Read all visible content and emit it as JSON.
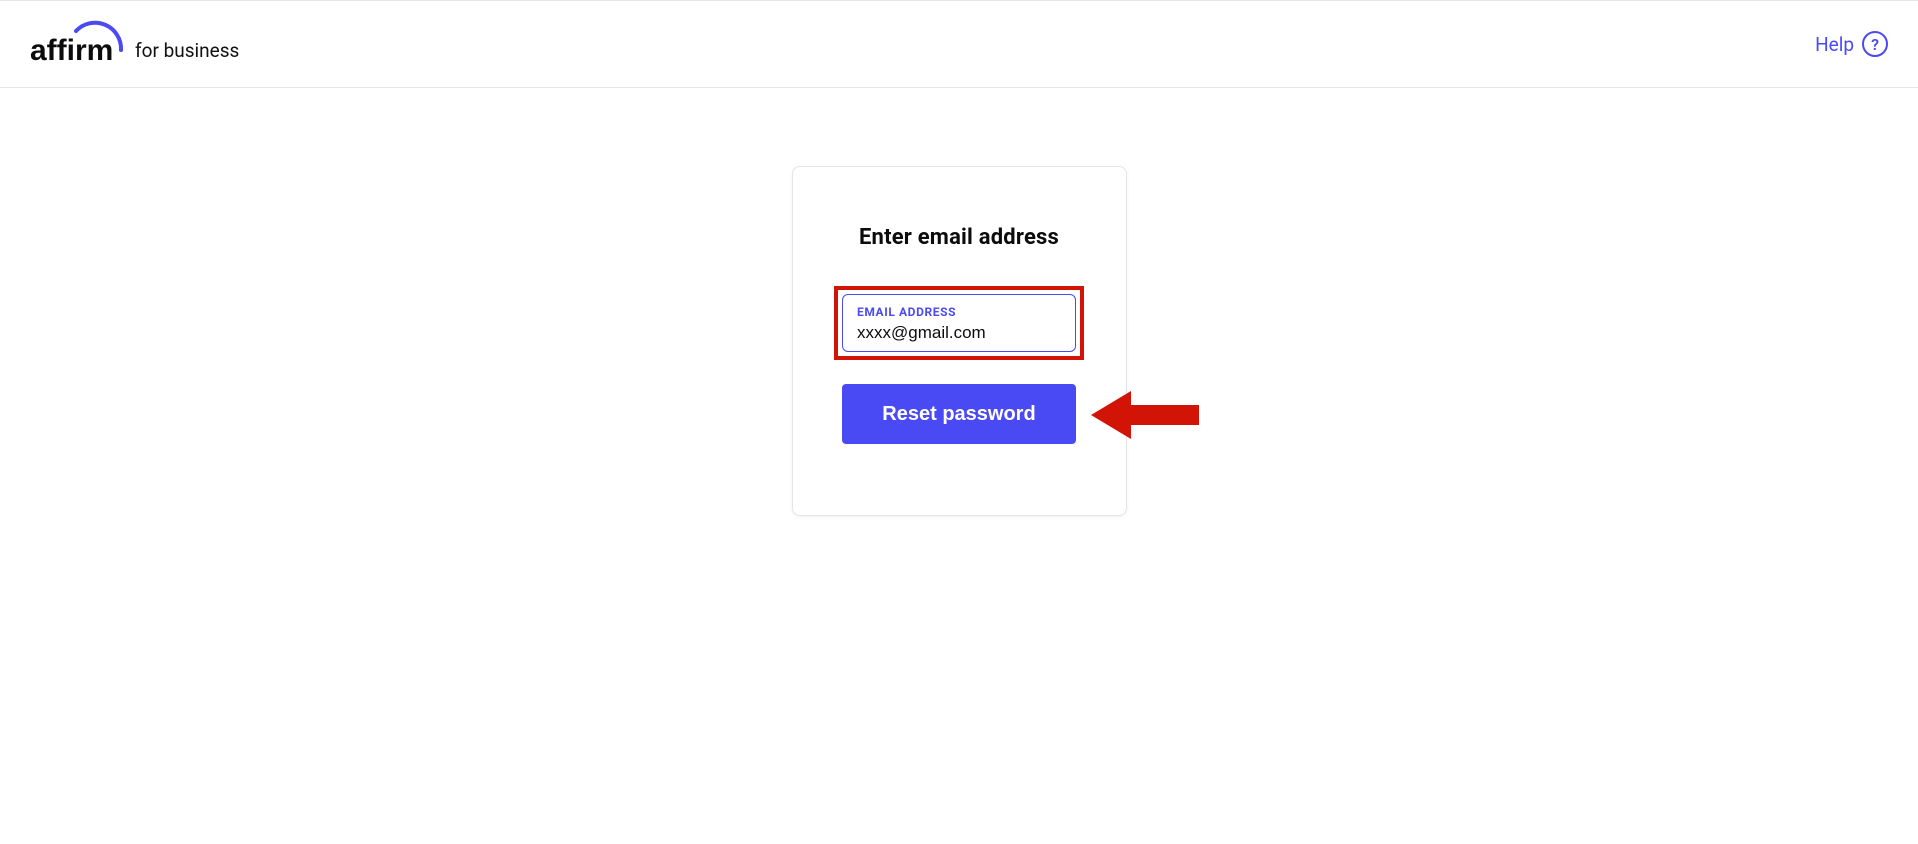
{
  "header": {
    "brand_sub": "for business",
    "help_label": "Help"
  },
  "card": {
    "title": "Enter email address",
    "email_label": "EMAIL ADDRESS",
    "email_value": "xxxx@gmail.com",
    "reset_button": "Reset password"
  }
}
